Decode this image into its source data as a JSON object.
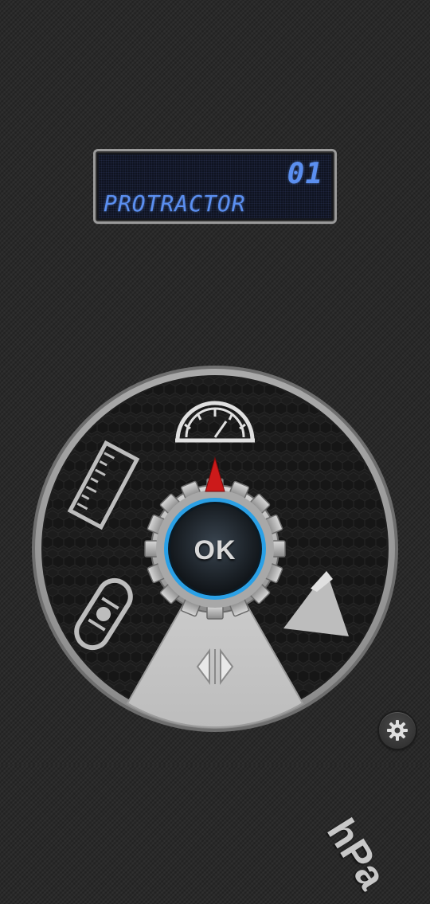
{
  "lcd": {
    "number": "01",
    "mode": "PROTRACTOR"
  },
  "dial": {
    "ok_label": "OK",
    "items": [
      {
        "name": "protractor",
        "icon": "protractor-icon"
      },
      {
        "name": "ruler",
        "icon": "ruler-icon"
      },
      {
        "name": "barometer",
        "icon": "hpa-icon",
        "label": "hPa"
      },
      {
        "name": "level",
        "icon": "bubble-level-icon"
      },
      {
        "name": "altitude",
        "icon": "mountain-icon"
      },
      {
        "name": "vibration",
        "icon": "vibration-icon"
      }
    ],
    "selector_pointer_color": "#cc1a1a",
    "ring_accent_color": "#2aa0e6"
  },
  "settings": {
    "icon": "gear-icon"
  }
}
